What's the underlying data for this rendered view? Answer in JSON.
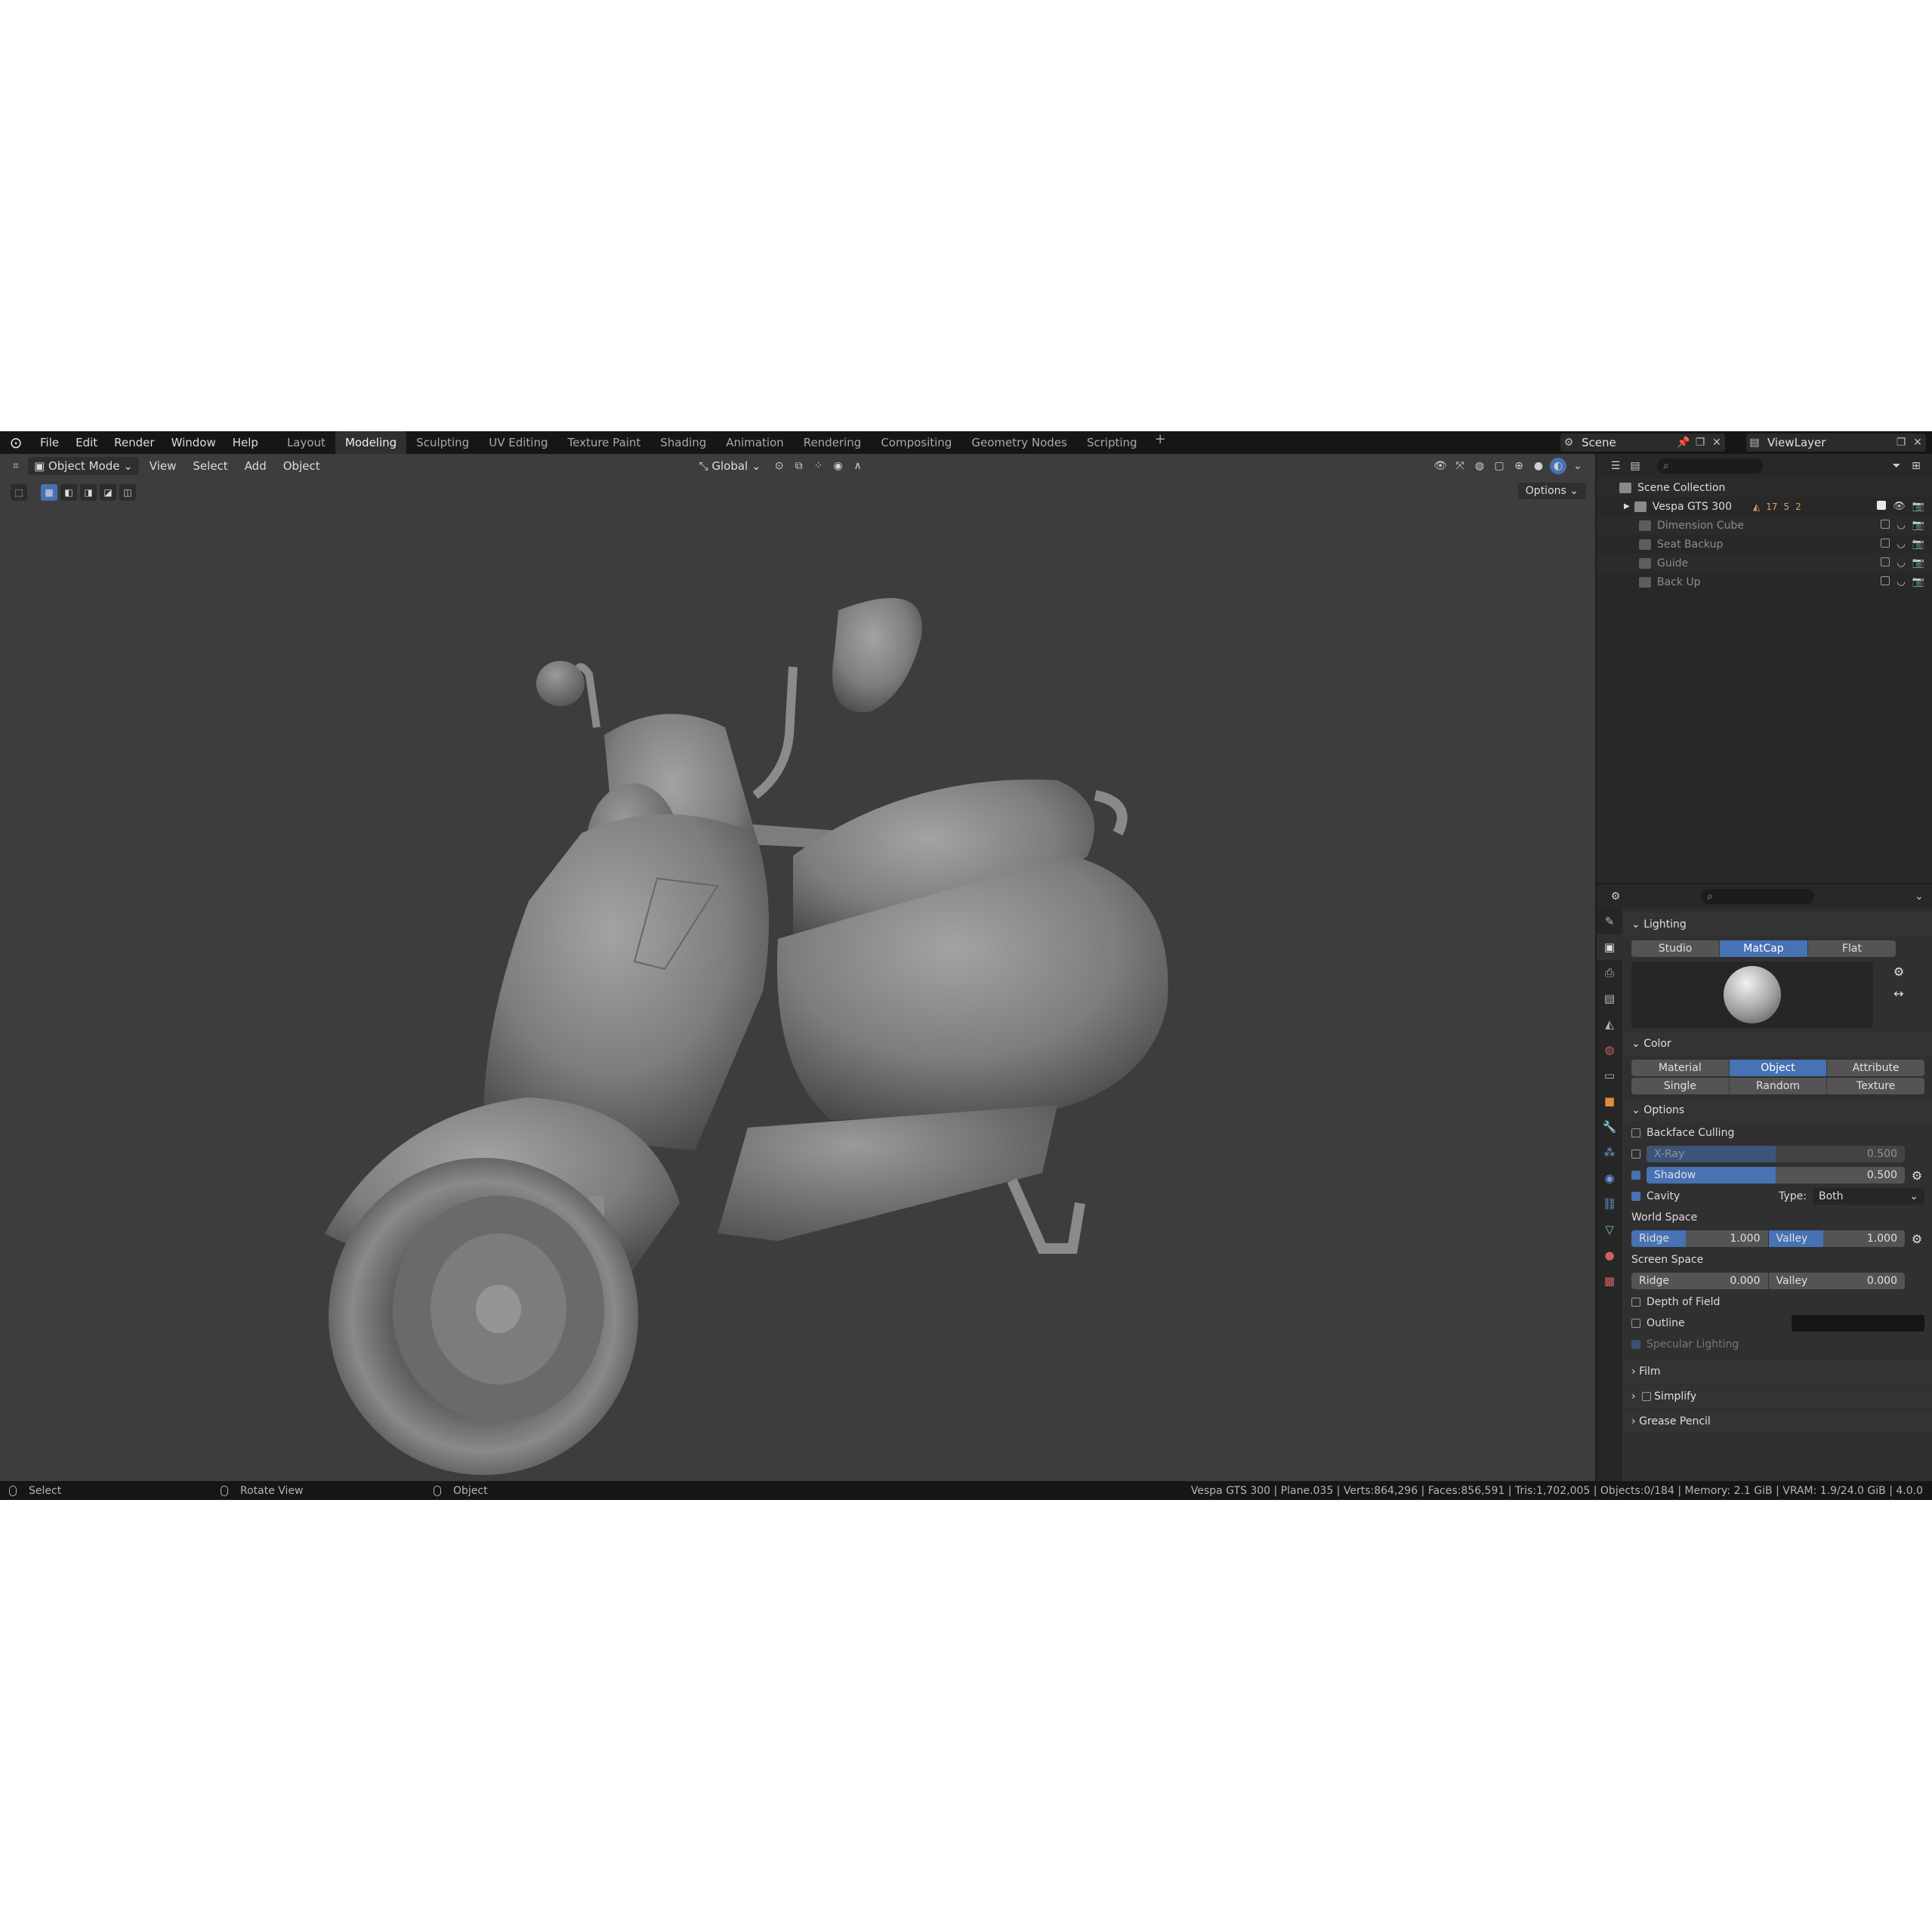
{
  "menu": [
    "File",
    "Edit",
    "Render",
    "Window",
    "Help"
  ],
  "workspaces": [
    "Layout",
    "Modeling",
    "Sculpting",
    "UV Editing",
    "Texture Paint",
    "Shading",
    "Animation",
    "Rendering",
    "Compositing",
    "Geometry Nodes",
    "Scripting"
  ],
  "active_workspace": "Modeling",
  "scene": {
    "name": "Scene"
  },
  "view_layer": {
    "name": "ViewLayer"
  },
  "viewport": {
    "mode": "Object Mode",
    "menus": [
      "View",
      "Select",
      "Add",
      "Object"
    ],
    "orientation": "Global",
    "options_label": "Options"
  },
  "outliner": {
    "root": "Scene Collection",
    "items": [
      {
        "label": "Vespa GTS 300",
        "counts": [
          "17",
          "5",
          "2"
        ],
        "enabled": true
      },
      {
        "label": "Dimension Cube",
        "enabled": false
      },
      {
        "label": "Seat Backup",
        "enabled": false
      },
      {
        "label": "Guide",
        "enabled": false
      },
      {
        "label": "Back Up",
        "enabled": false
      }
    ]
  },
  "properties": {
    "lighting": {
      "title": "Lighting",
      "options": [
        "Studio",
        "MatCap",
        "Flat"
      ],
      "active": "MatCap"
    },
    "color": {
      "title": "Color",
      "options": [
        "Material",
        "Object",
        "Attribute",
        "Single",
        "Random",
        "Texture"
      ],
      "active": "Object"
    },
    "options": {
      "title": "Options",
      "backface_culling": "Backface Culling",
      "xray": {
        "label": "X-Ray",
        "value": "0.500",
        "fraction": 0.5,
        "enabled": false
      },
      "shadow": {
        "label": "Shadow",
        "value": "0.500",
        "fraction": 0.5,
        "enabled": true
      },
      "cavity": {
        "label": "Cavity",
        "enabled": true,
        "type_label": "Type:",
        "type_value": "Both"
      },
      "world_space": {
        "label": "World Space",
        "ridge_label": "Ridge",
        "ridge": "1.000",
        "valley_label": "Valley",
        "valley": "1.000"
      },
      "screen_space": {
        "label": "Screen Space",
        "ridge_label": "Ridge",
        "ridge": "0.000",
        "valley_label": "Valley",
        "valley": "0.000"
      },
      "depth_of_field": "Depth of Field",
      "outline": "Outline",
      "specular": "Specular Lighting"
    },
    "collapsed_panels": [
      "Film",
      "Simplify",
      "Grease Pencil"
    ]
  },
  "statusbar": {
    "left": "Select",
    "middle": "Rotate View",
    "right": "Object",
    "stats": "Vespa GTS 300 | Plane.035 | Verts:864,296 | Faces:856,591 | Tris:1,702,005 | Objects:0/184 | Memory: 2.1 GiB | VRAM: 1.9/24.0 GiB | 4.0.0"
  },
  "colors": {
    "accent": "#4772b3",
    "viewport_bg": "#3d3d3d",
    "panel_bg": "#303030",
    "topbar_bg": "#161616"
  }
}
